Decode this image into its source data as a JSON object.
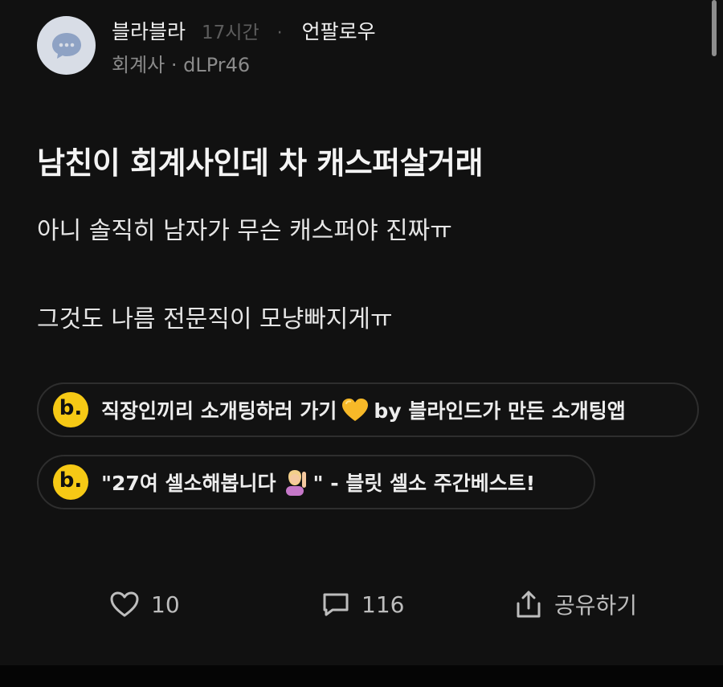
{
  "author": {
    "name": "블라블라",
    "time": "17시간",
    "separator": "·",
    "unfollow_label": "언팔로우",
    "company_line": "회계사 · dLPr46",
    "avatar_icon": "chat-bubble-icon",
    "avatar_bg": "#d8dde6",
    "avatar_fg": "#7b8fb2"
  },
  "post": {
    "title": "남친이 회계사인데 차 캐스퍼살거래",
    "body_lines": [
      "아니 솔직히 남자가 무슨 캐스퍼야 진짜ㅠ",
      "그것도 나름 전문직이 모냥빠지게ㅠ"
    ]
  },
  "promos": [
    {
      "badge": "b.",
      "text_before": "직장인끼리 소개팅하러 가기",
      "emoji": "yellow-heart-icon",
      "text_after": " by 블라인드가 만든 소개팅앱"
    },
    {
      "badge": "b.",
      "text_before": "\"27여 셀소해봅니다",
      "emoji": "person-raising-hand-icon",
      "text_after": "\" - 블릿 셀소 주간베스트!"
    }
  ],
  "actions": {
    "like_count": "10",
    "comment_count": "116",
    "share_label": "공유하기"
  },
  "colors": {
    "background": "#111111",
    "badge_yellow": "#f6c915",
    "pill_border": "#2e2e2e"
  }
}
